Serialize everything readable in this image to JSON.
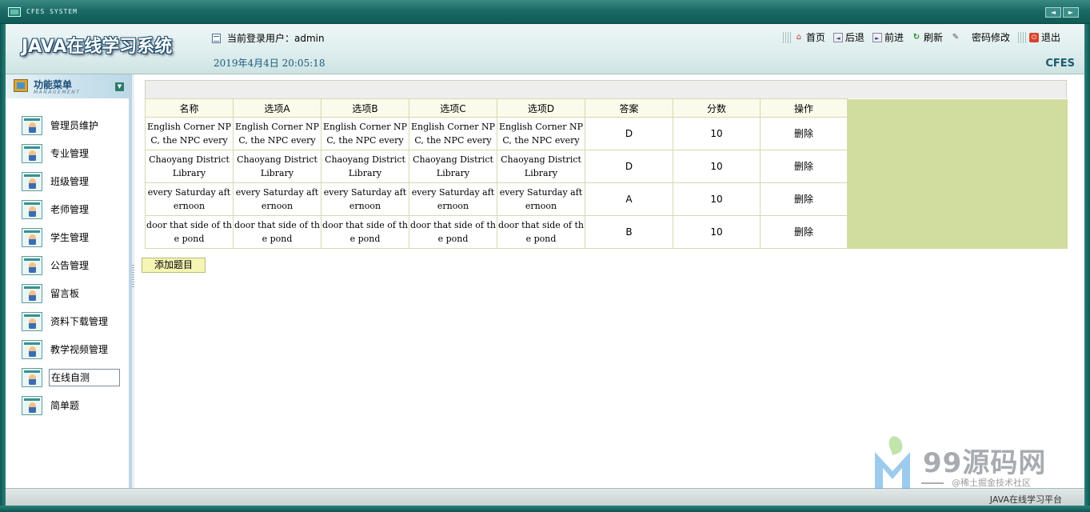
{
  "window": {
    "title": "CFES SYSTEM",
    "nav_prev": "◄",
    "nav_next": "►"
  },
  "header": {
    "logo": "JAVA在线学习系统",
    "user_prefix": "当前登录用户：",
    "user_name": "admin",
    "user_line": "当前登录用户：admin",
    "datetime": "2019年4月4日  20:05:18",
    "brand": "CFES",
    "links": {
      "home": "首页",
      "back": "后退",
      "forward": "前进",
      "refresh": "刷新",
      "password": "密码修改",
      "logout": "退出"
    }
  },
  "sidebar": {
    "title": "功能菜单",
    "subtitle": "MANAGEMENT",
    "items": [
      {
        "label": "管理员维护"
      },
      {
        "label": "专业管理"
      },
      {
        "label": "班级管理"
      },
      {
        "label": "老师管理"
      },
      {
        "label": "学生管理"
      },
      {
        "label": "公告管理"
      },
      {
        "label": "留言板"
      },
      {
        "label": "资料下载管理"
      },
      {
        "label": "教学视频管理"
      },
      {
        "label": "在线自测"
      },
      {
        "label": "简单题"
      }
    ],
    "active_index": 9
  },
  "table": {
    "columns": [
      "名称",
      "选项A",
      "选项B",
      "选项C",
      "选项D",
      "答案",
      "分数",
      "操作"
    ],
    "rows": [
      {
        "name": "English Corner NPC, the NPC every",
        "a": "English Corner NPC, the NPC every",
        "b": "English Corner NPC, the NPC every",
        "c": "English Corner NPC, the NPC every",
        "d": "English Corner NPC, the NPC every",
        "answer": "D",
        "score": "10",
        "action": "删除"
      },
      {
        "name": "Chaoyang District Library",
        "a": "Chaoyang District Library",
        "b": "Chaoyang District Library",
        "c": "Chaoyang District Library",
        "d": "Chaoyang District Library",
        "answer": "D",
        "score": "10",
        "action": "删除"
      },
      {
        "name": "every Saturday afternoon",
        "a": "every Saturday afternoon",
        "b": "every Saturday afternoon",
        "c": "every Saturday afternoon",
        "d": "every Saturday afternoon",
        "answer": "A",
        "score": "10",
        "action": "删除"
      },
      {
        "name": "door that side of the pond",
        "a": "door that side of the pond",
        "b": "door that side of the pond",
        "c": "door that side of the pond",
        "d": "door that side of the pond",
        "answer": "B",
        "score": "10",
        "action": "删除"
      }
    ],
    "add_button": "添加题目"
  },
  "statusbar": {
    "text": "JAVA在线学习平台"
  },
  "watermark": {
    "brand": "99源码网",
    "caption": "@稀土掘金技术社区"
  },
  "colors": {
    "titlebar": "#1c6b66",
    "table_header_bg": "#fbfbec",
    "filler_green": "#d1dc9f",
    "add_button_bg": "#f6f6b4",
    "date_text": "#1a5a80"
  }
}
